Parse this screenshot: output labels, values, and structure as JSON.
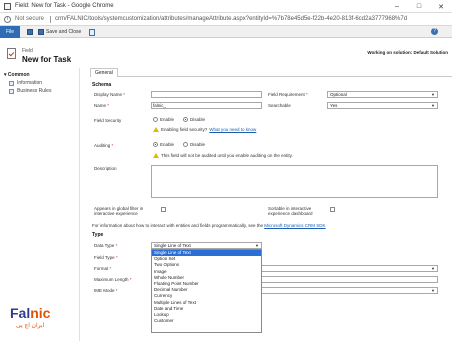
{
  "window": {
    "title": "Field: New for Task - Google Chrome",
    "not_secure": "Not secure",
    "url": "crm/FALNIC/tools/systemcustomization/attributes/manageAttribute.aspx?entityId=%7b78e45d5e-f22b-4e20-813f-6cd2a3777968%7d"
  },
  "toolbar": {
    "file": "File",
    "save_close": "Save and Close",
    "help": "?"
  },
  "header": {
    "subtitle": "Field",
    "title": "New for Task",
    "working_on": "Working on solution: Default Solution"
  },
  "nav": {
    "common": "Common",
    "items": [
      {
        "label": "Information"
      },
      {
        "label": "Business Rules"
      }
    ]
  },
  "tabs": {
    "general": "General"
  },
  "schema": {
    "heading": "Schema",
    "display_name_label": "Display Name",
    "display_name_value": "",
    "field_requirement_label": "Field Requirement",
    "field_requirement_value": "Optional",
    "name_label": "Name",
    "name_value": "falnic_",
    "searchable_label": "Searchable",
    "searchable_value": "Yes",
    "field_security_label": "Field Security",
    "enable": "Enable",
    "disable": "Disable",
    "security_warning": "Enabling field security?",
    "security_link": "What you need to know",
    "auditing_label": "Auditing",
    "auditing_warning": "This field will not be audited until you enable auditing on the entity.",
    "description_label": "Description",
    "global_filter_label_1": "Appears in global filter in",
    "global_filter_label_2": "interactive experience",
    "sortable_label_1": "Sortable in interactive",
    "sortable_label_2": "experience dashboard",
    "info_text": "For information about how to interact with entities and fields programmatically, see the",
    "info_link": "Microsoft Dynamics CRM SDK"
  },
  "type": {
    "heading": "Type",
    "data_type_label": "Data Type",
    "data_type_value": "Single Line of Text",
    "field_type_label": "Field Type",
    "format_label": "Format",
    "max_length_label": "Maximum Length",
    "ime_mode_label": "IME Mode",
    "options": [
      "Single Line of Text",
      "Option Set",
      "Two Options",
      "Image",
      "Whole Number",
      "Floating Point Number",
      "Decimal Number",
      "Currency",
      "Multiple Lines of Text",
      "Date and Time",
      "Lookup",
      "Customer"
    ]
  },
  "watermark": {
    "brand_prefix": "Fal",
    "brand_suffix": "nic",
    "tagline": "ایران اچ پی"
  }
}
